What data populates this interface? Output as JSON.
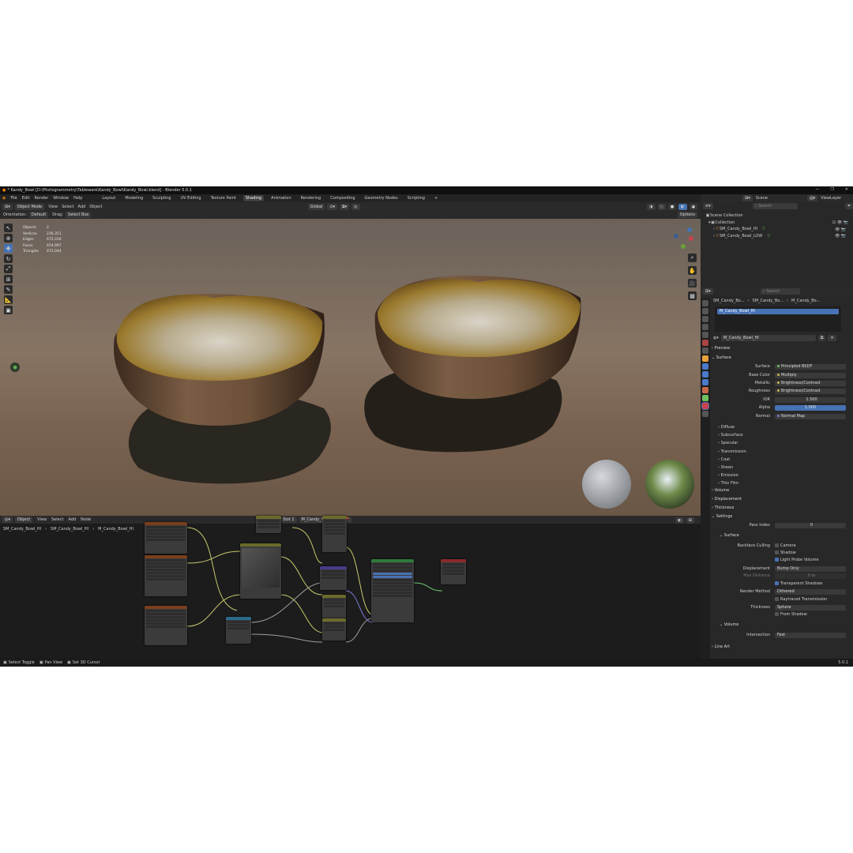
{
  "window": {
    "title": "* Kandy_Bowl [D:\\Photogrammetry\\Tableware\\Kandy_Bowl\\Kandy_Bowl.blend] - Blender 5.0.1"
  },
  "menu": [
    "File",
    "Edit",
    "Render",
    "Window",
    "Help"
  ],
  "workspaces": [
    "Layout",
    "Modeling",
    "Sculpting",
    "UV Editing",
    "Texture Paint",
    "Shading",
    "Animation",
    "Rendering",
    "Compositing",
    "Geometry Nodes",
    "Scripting"
  ],
  "active_workspace": "Shading",
  "add_tab": "+",
  "viewport": {
    "mode": "Object Mode",
    "menus": [
      "View",
      "Select",
      "Add",
      "Object"
    ],
    "transform": "Global",
    "orientation_label": "Orientation:",
    "orientation_value": "Default",
    "drag_label": "Drag:",
    "drag_value": "Select Box",
    "options": "Options",
    "stats": [
      {
        "label": "Objects",
        "value": "2"
      },
      {
        "label": "Vertices",
        "value": "236,351"
      },
      {
        "label": "Edges",
        "value": "672,316"
      },
      {
        "label": "Faces",
        "value": "454,997"
      },
      {
        "label": "Triangles",
        "value": "472,044"
      }
    ]
  },
  "scene": {
    "label": "Scene",
    "view_layer": "ViewLayer",
    "search_placeholder": "Search"
  },
  "outliner": {
    "root": "Scene Collection",
    "collection": "Collection",
    "objects": [
      "SM_Candy_Bowl_HI",
      "SM_Candy_Bowl_LOW"
    ]
  },
  "node_editor": {
    "type": "Object",
    "menus": [
      "View",
      "Select",
      "Add",
      "Node"
    ],
    "slot": "Slot 1",
    "material": "M_Candy_Bowl_HI",
    "breadcrumb": [
      "SM_Candy_Bowl_HI",
      "SM_Candy_Bowl_HI",
      "M_Candy_Bowl_HI"
    ]
  },
  "properties": {
    "search_placeholder": "Search",
    "breadcrumb": [
      "SM_Candy_Bo...",
      "SM_Candy_Bo...",
      "M_Candy_Bo..."
    ],
    "material_slot": "M_Candy_Bowl_HI",
    "material_name": "M_Candy_Bowl_HI",
    "sections": {
      "preview": "Preview",
      "surface": "Surface"
    },
    "surface": {
      "surface_label": "Surface",
      "surface_value": "Principled BSDF",
      "base_color_label": "Base Color",
      "base_color_value": "Multiply",
      "metallic_label": "Metallic",
      "metallic_value": "Brightness/Contrast",
      "roughness_label": "Roughness",
      "roughness_value": "Brightness/Contrast",
      "ior_label": "IOR",
      "ior_value": "1.500",
      "alpha_label": "Alpha",
      "alpha_value": "1.000",
      "normal_label": "Normal",
      "normal_value": "Normal Map"
    },
    "subpanels": [
      "Diffuse",
      "Subsurface",
      "Specular",
      "Transmission",
      "Coat",
      "Sheen",
      "Emission",
      "Thin Film"
    ],
    "volume": "Volume",
    "displacement": "Displacement",
    "thickness": "Thickness",
    "settings": {
      "title": "Settings",
      "pass_index_label": "Pass Index",
      "pass_index_value": "0",
      "surface_title": "Surface",
      "backface_culling_label": "Backface Culling",
      "camera": "Camera",
      "shadow": "Shadow",
      "light_probe_volume": "Light Probe Volume",
      "displacement_label": "Displacement",
      "displacement_value": "Bump Only",
      "max_distance_label": "Max Distance",
      "max_distance_value": "0 m",
      "transparent_shadows": "Transparent Shadows",
      "render_method_label": "Render Method",
      "render_method_value": "Dithered",
      "raytraced_transmission": "Raytraced Transmission",
      "thickness_label": "Thickness",
      "thickness_value": "Sphere",
      "from_shadow": "From Shadow",
      "volume_title": "Volume",
      "intersection_label": "Intersection",
      "intersection_value": "Fast",
      "line_art": "Line Art"
    }
  },
  "status": {
    "items": [
      "Select Toggle",
      "Pan View",
      "Set 3D Cursor"
    ],
    "version": "5.0.1"
  },
  "colors": {
    "accent": "#4772b3",
    "header": "#2a2a2a",
    "panel": "#282828"
  }
}
